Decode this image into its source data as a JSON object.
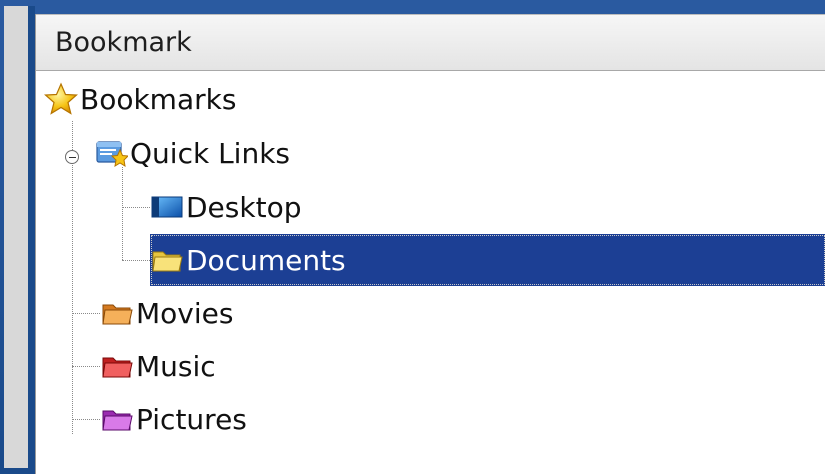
{
  "panel": {
    "header_title": "Bookmark"
  },
  "tree": {
    "root": {
      "label": "Bookmarks",
      "icon": "star-icon"
    },
    "quick_links": {
      "label": "Quick Links",
      "icon": "bookmark-folder-icon",
      "expanded": true
    },
    "desktop": {
      "label": "Desktop",
      "icon": "desktop-icon"
    },
    "documents": {
      "label": "Documents",
      "icon": "folder-yellow-icon",
      "selected": true
    },
    "movies": {
      "label": "Movies",
      "icon": "folder-orange-icon"
    },
    "music": {
      "label": "Music",
      "icon": "folder-red-icon"
    },
    "pictures": {
      "label": "Pictures",
      "icon": "folder-purple-icon"
    }
  },
  "colors": {
    "selection": "#1c3f94",
    "frame": "#1a4a8a"
  }
}
